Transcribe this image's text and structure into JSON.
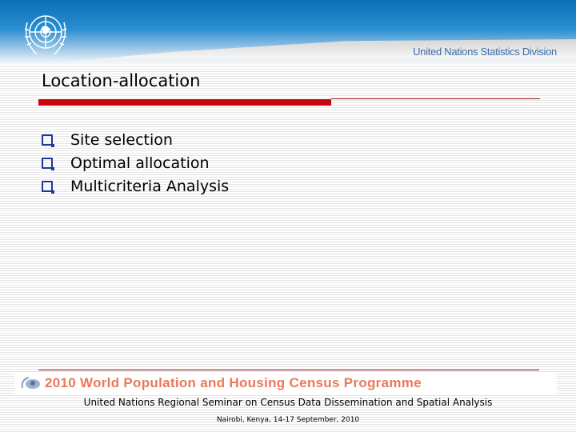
{
  "header": {
    "organization": "United Nations Statistics Division",
    "logo": "un-emblem"
  },
  "slide": {
    "title": "Location-allocation",
    "bullets": [
      {
        "label": "Site selection"
      },
      {
        "label": "Optimal allocation"
      },
      {
        "label": "Multicriteria Analysis"
      }
    ]
  },
  "footer": {
    "banner": "2010 World Population and Housing Census Programme",
    "seminar": "United Nations Regional Seminar on Census Data Dissemination and Spatial Analysis",
    "place_date": "Nairobi, Kenya, 14-17 September, 2010"
  },
  "colors": {
    "accent_red": "#c8060b",
    "header_blue": "#0a6fb8",
    "bullet_blue": "#1a3a9a",
    "banner_orange": "#e9795a"
  }
}
